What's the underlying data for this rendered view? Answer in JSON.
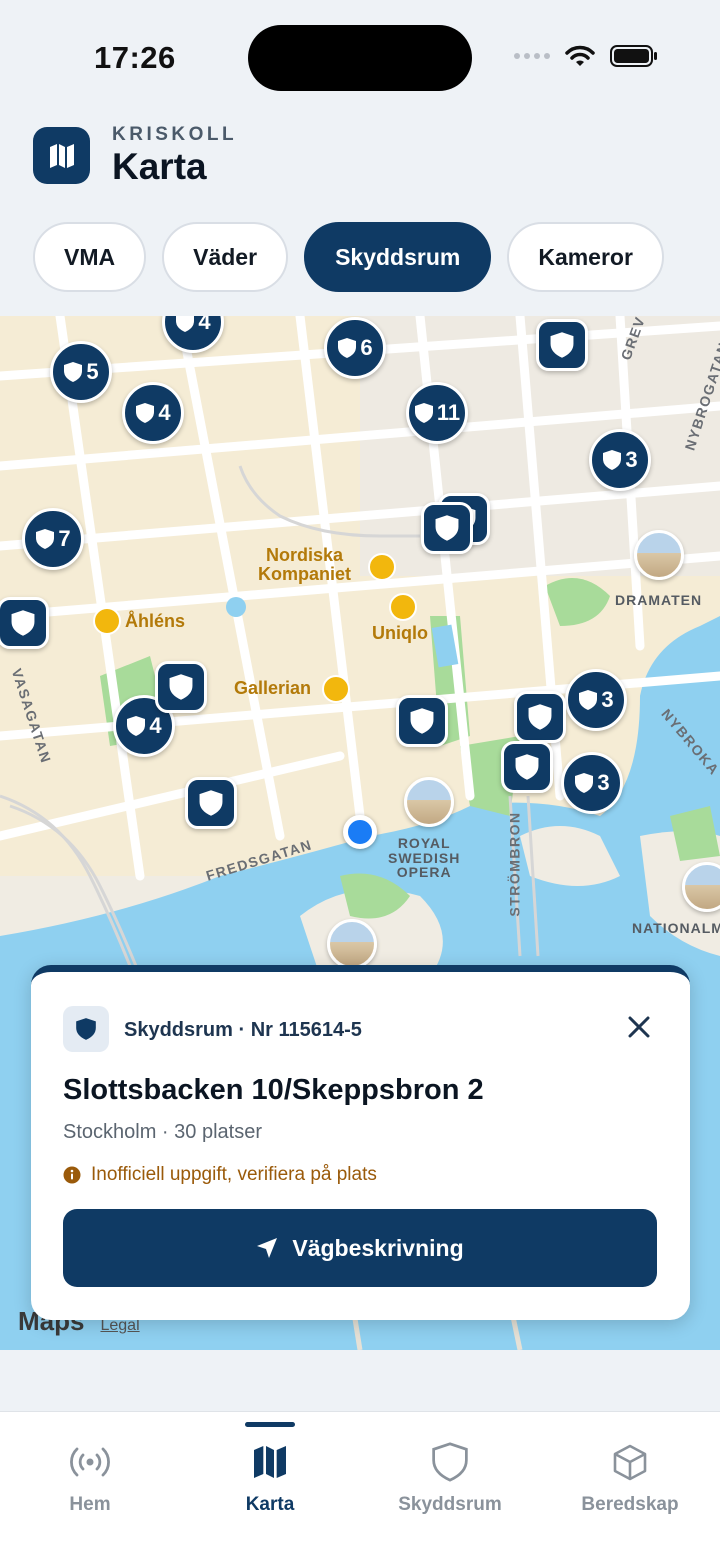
{
  "status": {
    "time": "17:26"
  },
  "header": {
    "brand": "KRISKOLL",
    "title": "Karta"
  },
  "filters": [
    {
      "label": "VMA",
      "active": false
    },
    {
      "label": "Väder",
      "active": false
    },
    {
      "label": "Skyddsrum",
      "active": true
    },
    {
      "label": "Kameror",
      "active": false
    }
  ],
  "map": {
    "places": {
      "nk": "Nordiska\nKompaniet",
      "ahlens": "Åhléns",
      "uniqlo": "Uniqlo",
      "gallerian": "Gallerian",
      "dramaten": "DRAMATEN",
      "opera": "ROYAL\nSWEDISH\nOPERA",
      "nationalm": "NATIONALM"
    },
    "streets": {
      "vasagatan": "VASAGATAN",
      "fredsgatan": "FREDSGATAN",
      "strombron": "STRÖMBRON",
      "nybrogatan": "NYBROGATAN",
      "nybrokajen": "NYBROKA",
      "grev": "GREV"
    },
    "clusters": [
      "4",
      "6",
      "5",
      "4",
      "11",
      "3",
      "7",
      "3",
      "4",
      "3"
    ],
    "attribution": {
      "logo": "Maps",
      "legal": "Legal"
    }
  },
  "card": {
    "type": "Skyddsrum · Nr 115614-5",
    "title": "Slottsbacken 10/Skeppsbron 2",
    "subtitle": "Stockholm · 30 platser",
    "warning": "Inofficiell uppgift, verifiera på plats",
    "button": "Vägbeskrivning"
  },
  "tabs": [
    {
      "label": "Hem",
      "icon": "broadcast-icon"
    },
    {
      "label": "Karta",
      "icon": "map-icon"
    },
    {
      "label": "Skyddsrum",
      "icon": "shield-icon"
    },
    {
      "label": "Beredskap",
      "icon": "box-icon"
    }
  ],
  "colors": {
    "primary": "#0f3a64",
    "warning": "#9a5a0a",
    "water": "#8fd0f0",
    "park": "#a8db9a"
  }
}
